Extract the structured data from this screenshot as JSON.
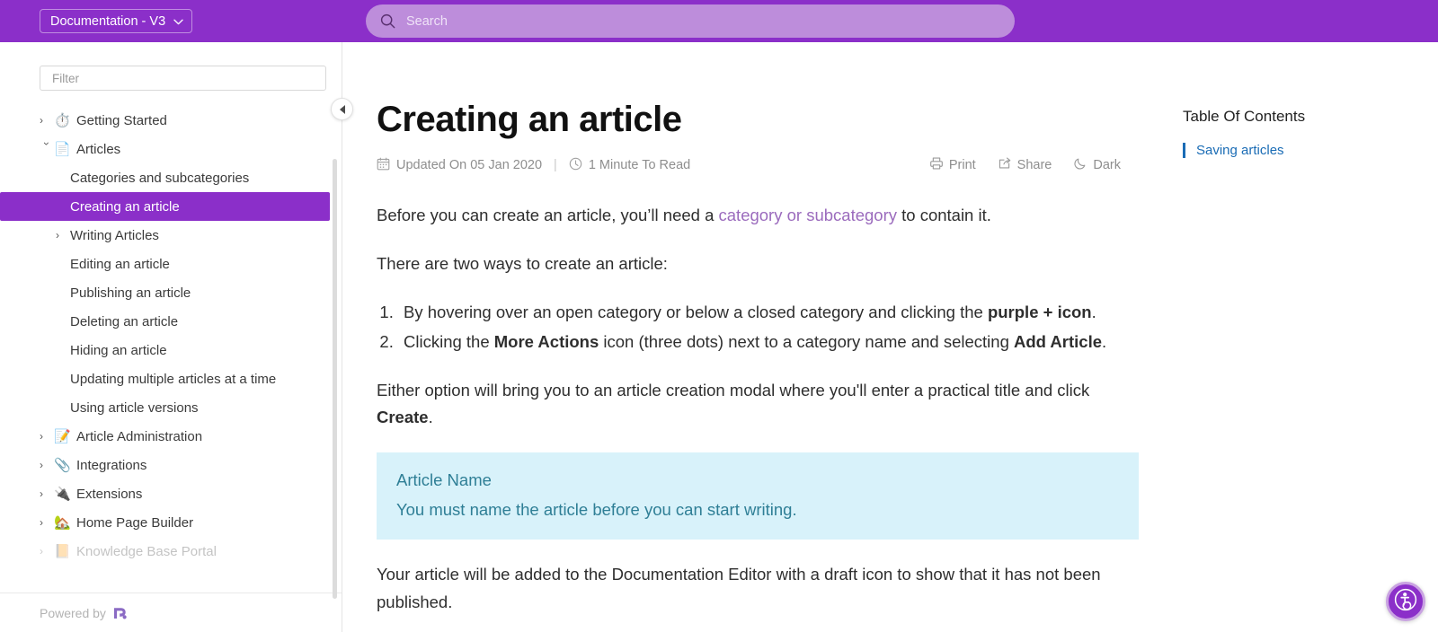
{
  "header": {
    "version_label": "Documentation - V3",
    "chevron": "⌄",
    "search_placeholder": "Search",
    "search_value": "",
    "brand_color": "#8b2fc9",
    "search_bg": "#bd8ddb"
  },
  "sidebar": {
    "filter_placeholder": "Filter",
    "filter_value": "",
    "powered_by": "Powered by",
    "items": [
      {
        "label": "Getting Started",
        "emoji": "⏱️",
        "caret": "›",
        "level": "top",
        "state": "collapsed"
      },
      {
        "label": "Articles",
        "emoji": "📄",
        "caret": "›",
        "level": "top",
        "state": "expanded"
      },
      {
        "label": "Categories and subcategories",
        "emoji": "",
        "caret": "",
        "level": "child",
        "state": ""
      },
      {
        "label": "Creating an article",
        "emoji": "",
        "caret": "",
        "level": "child",
        "state": "active"
      },
      {
        "label": "Writing Articles",
        "emoji": "",
        "caret": "›",
        "level": "child-caret",
        "state": "collapsed"
      },
      {
        "label": "Editing an article",
        "emoji": "",
        "caret": "",
        "level": "child",
        "state": ""
      },
      {
        "label": "Publishing an article",
        "emoji": "",
        "caret": "",
        "level": "child",
        "state": ""
      },
      {
        "label": "Deleting an article",
        "emoji": "",
        "caret": "",
        "level": "child",
        "state": ""
      },
      {
        "label": "Hiding an article",
        "emoji": "",
        "caret": "",
        "level": "child",
        "state": ""
      },
      {
        "label": "Updating multiple articles at a time",
        "emoji": "",
        "caret": "",
        "level": "child",
        "state": ""
      },
      {
        "label": "Using article versions",
        "emoji": "",
        "caret": "",
        "level": "child",
        "state": ""
      },
      {
        "label": "Article Administration",
        "emoji": "📝",
        "caret": "›",
        "level": "top",
        "state": "collapsed"
      },
      {
        "label": "Integrations",
        "emoji": "📎",
        "caret": "›",
        "level": "top",
        "state": "collapsed"
      },
      {
        "label": "Extensions",
        "emoji": "🔌",
        "caret": "›",
        "level": "top",
        "state": "collapsed"
      },
      {
        "label": "Home Page Builder",
        "emoji": "🏡",
        "caret": "›",
        "level": "top",
        "state": "collapsed"
      },
      {
        "label": "Knowledge Base Portal",
        "emoji": "📙",
        "caret": "›",
        "level": "top",
        "state": "clipped"
      }
    ]
  },
  "article": {
    "title": "Creating an article",
    "updated_on": "Updated On 05 Jan 2020",
    "read_time": "1 Minute To Read",
    "separator": "|",
    "actions": [
      {
        "label": "Print",
        "icon": "printer-icon"
      },
      {
        "label": "Share",
        "icon": "share-icon"
      },
      {
        "label": "Dark",
        "icon": "moon-icon"
      }
    ],
    "intro_before": "Before you can create an article, you’ll need a ",
    "intro_link": "category or subcategory",
    "intro_after": " to contain it.",
    "lead": "There are two ways to create an article:",
    "steps": [
      {
        "pre": "By hovering over an open category or below a closed category and clicking the ",
        "bold": "purple + icon",
        "post": "."
      },
      {
        "pre": "Clicking the ",
        "bold": "More Actions",
        "mid": " icon (three dots) next to a category name and selecting ",
        "bold2": "Add Article",
        "post": "."
      }
    ],
    "modal_para_pre": "Either option will bring you to an article creation modal where you'll enter a practical title and click ",
    "modal_para_bold": "Create",
    "modal_para_post": ".",
    "callout": {
      "title": "Article Name",
      "body": "You must name the article before you can start writing.",
      "bg": "#d8f2fa",
      "text_color": "#2f7f96"
    },
    "closing_para": "Your article will be added to the Documentation Editor with a draft icon to show that it has not been published."
  },
  "toc": {
    "title": "Table Of Contents",
    "items": [
      {
        "label": "Saving articles",
        "color": "#1a6cb5"
      }
    ]
  },
  "widgets": {
    "accessibility_label": "accessibility-icon"
  }
}
